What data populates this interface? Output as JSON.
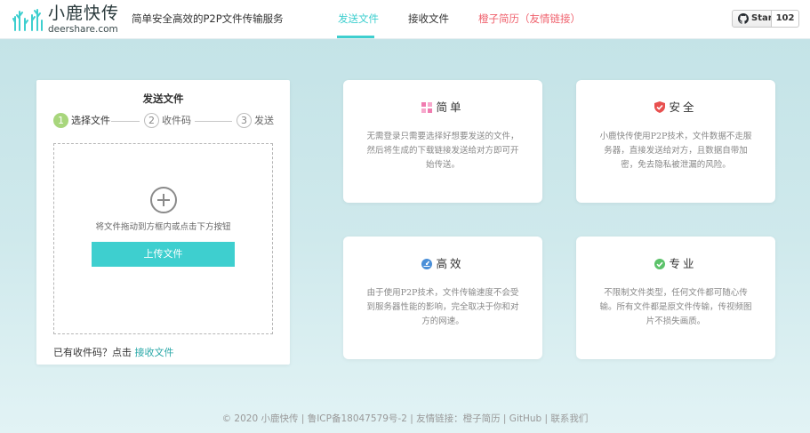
{
  "header": {
    "logo_title": "小鹿快传",
    "logo_domain": "deershare.com",
    "slogan": "简单安全高效的P2P文件传输服务",
    "nav": {
      "send": "发送文件",
      "receive": "接收文件",
      "resume": "橙子简历（友情链接）"
    },
    "github": {
      "star_label": "Star",
      "star_count": "102"
    }
  },
  "send_panel": {
    "title": "发送文件",
    "steps": [
      {
        "num": "1",
        "label": "选择文件"
      },
      {
        "num": "2",
        "label": "收件码"
      },
      {
        "num": "3",
        "label": "发送"
      }
    ],
    "active_step": 1,
    "drop_hint": "将文件拖动到方框内或点击下方按钮",
    "upload_label": "上传文件",
    "have_code_text": "已有收件码？点击 ",
    "receive_link": "接收文件"
  },
  "features": [
    {
      "title": "简单",
      "icon": "grid-icon",
      "text": "无需登录只需要选择好想要发送的文件，然后将生成的下载链接发送给对方即可开始传送。"
    },
    {
      "title": "安全",
      "icon": "shield-icon",
      "text": "小鹿快传使用P2P技术，文件数据不走服务器，直接发送给对方，且数据自带加密，免去隐私被泄漏的风险。"
    },
    {
      "title": "高效",
      "icon": "speedometer-icon",
      "text": "由于使用P2P技术，文件传输速度不会受到服务器性能的影响，完全取决于你和对方的网速。"
    },
    {
      "title": "专业",
      "icon": "check-circle-icon",
      "text": "不限制文件类型，任何文件都可随心传输。所有文件都是原文件传输，传视频图片不损失画质。"
    }
  ],
  "footer": {
    "text": "© 2020 小鹿快传 | 鲁ICP备18047579号-2 | 友情链接：橙子简历 | GitHub | 联系我们"
  },
  "colors": {
    "accent": "#3ecfcf",
    "link_red": "#ef5f6b",
    "step_active": "#a8d67c",
    "icon_pink": "#f07cb0",
    "icon_red": "#e8504f",
    "icon_blue": "#4a8fd8",
    "icon_green": "#5cc26a"
  }
}
